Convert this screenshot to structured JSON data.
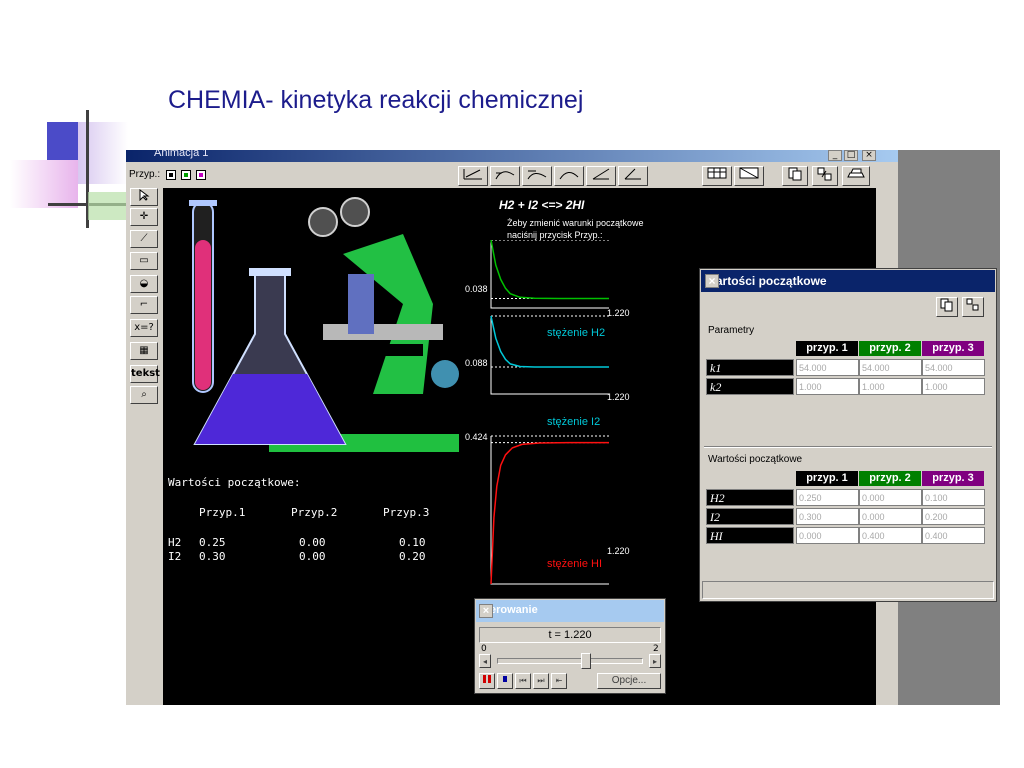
{
  "slide": {
    "title": "CHEMIA- kinetyka reakcji chemicznej"
  },
  "app": {
    "window_title": "Animacja 1",
    "przyp_label": "Przyp.:",
    "left_tool_tekst": "tekst",
    "left_tool_x": "x=?"
  },
  "canvas": {
    "equation": "H2 + I2 <=> 2HI",
    "note_line1": "Żeby zmienić warunki początkowe",
    "note_line2": "naciśnij przycisk Przyp.:",
    "initial_title": "Wartości początkowe:",
    "cols": [
      "Przyp.1",
      "Przyp.2",
      "Przyp.3"
    ],
    "rows": [
      {
        "label": "H2",
        "values": [
          "0.25",
          "0.00",
          "0.10"
        ]
      },
      {
        "label": "I2",
        "values": [
          "0.30",
          "0.00",
          "0.20"
        ]
      }
    ]
  },
  "chart_data": [
    {
      "type": "line",
      "ymax_label": "0.038",
      "xmax_label": "1.220",
      "name": "",
      "color": "#00c000",
      "points": [
        [
          0,
          0.038
        ],
        [
          0.05,
          0.024
        ],
        [
          0.1,
          0.016
        ],
        [
          0.15,
          0.011
        ],
        [
          0.2,
          0.008
        ],
        [
          0.3,
          0.006
        ],
        [
          0.45,
          0.0055
        ],
        [
          0.7,
          0.0053
        ],
        [
          1.22,
          0.0053
        ]
      ]
    },
    {
      "type": "line",
      "ymax_label": "0.088",
      "xmax_label": "1.220",
      "name": "stężenie H2",
      "color": "#00c8d8",
      "points": [
        [
          0,
          0.088
        ],
        [
          0.05,
          0.063
        ],
        [
          0.1,
          0.048
        ],
        [
          0.15,
          0.039
        ],
        [
          0.2,
          0.034
        ],
        [
          0.3,
          0.031
        ],
        [
          0.45,
          0.0305
        ],
        [
          0.7,
          0.0305
        ],
        [
          1.22,
          0.0305
        ]
      ]
    },
    {
      "type": "line",
      "ymax_label": "0.424",
      "xmax_label": "1.220",
      "name": "stężenie I2",
      "name2": "stężenie HI",
      "color": "#ff1010",
      "points": [
        [
          0,
          0.0
        ],
        [
          0.03,
          0.19
        ],
        [
          0.06,
          0.28
        ],
        [
          0.1,
          0.34
        ],
        [
          0.15,
          0.37
        ],
        [
          0.22,
          0.39
        ],
        [
          0.32,
          0.4
        ],
        [
          0.5,
          0.404
        ],
        [
          0.8,
          0.405
        ],
        [
          1.22,
          0.405
        ]
      ]
    }
  ],
  "dialog": {
    "title": "Wartości początkowe",
    "close": "×",
    "group1": "Parametry",
    "group2": "Wartości początkowe",
    "headers": [
      "przyp. 1",
      "przyp. 2",
      "przyp. 3"
    ],
    "header_colors": [
      "#000000",
      "#008000",
      "#800080"
    ],
    "params": [
      {
        "label": "k1",
        "values": [
          "54.000",
          "54.000",
          "54.000"
        ]
      },
      {
        "label": "k2",
        "values": [
          "1.000",
          "1.000",
          "1.000"
        ]
      }
    ],
    "initials": [
      {
        "label": "H2",
        "values": [
          "0.250",
          "0.000",
          "0.100"
        ]
      },
      {
        "label": "I2",
        "values": [
          "0.300",
          "0.000",
          "0.200"
        ]
      },
      {
        "label": "HI",
        "values": [
          "0.000",
          "0.400",
          "0.400"
        ]
      }
    ]
  },
  "control": {
    "title": "Sterowanie",
    "close": "×",
    "time_display": "t =  1.220",
    "slider_min": "0",
    "slider_max": "2",
    "slider_fraction": 0.61,
    "options_label": "Opcje..."
  }
}
